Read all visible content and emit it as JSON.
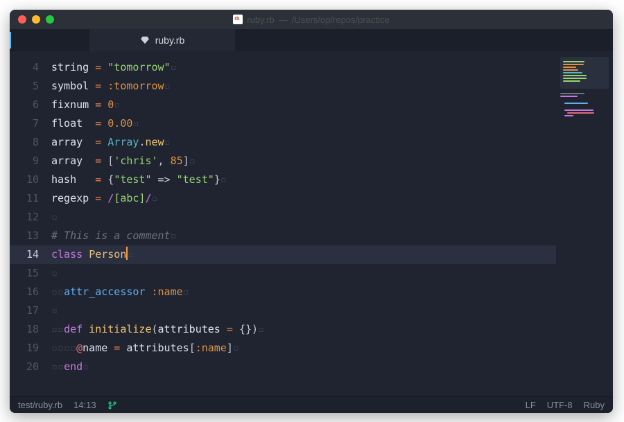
{
  "title": {
    "file": "ruby.rb",
    "path": "/Users/op/repos/practice",
    "sep": " — "
  },
  "tab": {
    "name": "ruby.rb"
  },
  "gutter": {
    "start": 4,
    "end": 20,
    "highlight": 14
  },
  "code": {
    "l4": {
      "var": "string",
      "op": "=",
      "str": "\"tomorrow\""
    },
    "l5": {
      "var": "symbol",
      "op": "=",
      "sym": ":tomorrow"
    },
    "l6": {
      "var": "fixnum",
      "op": "=",
      "num": "0"
    },
    "l7": {
      "var": "float ",
      "op": "=",
      "num": "0.00"
    },
    "l8": {
      "var": "array ",
      "op": "=",
      "const": "Array",
      "dot": ".",
      "meth": "new"
    },
    "l9": {
      "var": "array ",
      "op": "=",
      "lb": "[",
      "str": "'chris'",
      "comma": ", ",
      "num": "85",
      "rb": "]"
    },
    "l10": {
      "var": "hash  ",
      "op": "=",
      "lb": "{",
      "k": "\"test\"",
      "arrow": " => ",
      "v": "\"test\"",
      "rb": "}"
    },
    "l11": {
      "var": "regexp",
      "op": "=",
      "slash1": "/",
      "body": "[abc]",
      "slash2": "/"
    },
    "l13": {
      "comment": "# This is a comment"
    },
    "l14": {
      "kw": "class",
      "name": "Person"
    },
    "l16": {
      "attr": "attr_accessor",
      "sym": ":name"
    },
    "l18": {
      "kw": "def",
      "meth": "initialize",
      "lp": "(",
      "arg": "attributes",
      "opeq": " = ",
      "lb": "{}",
      "rp": ")"
    },
    "l19": {
      "at": "@",
      "ivar": "name",
      "opeq": " = ",
      "rhs": "attributes",
      "lb": "[",
      "sym": ":name",
      "rb": "]"
    },
    "l20": {
      "kw": "end"
    }
  },
  "status": {
    "path": "test/ruby.rb",
    "cursor": "14:13",
    "line_ending": "LF",
    "encoding": "UTF-8",
    "language": "Ruby"
  },
  "minimap": {
    "colors": [
      "#98d472",
      "#de9243",
      "#de9243",
      "#de9243",
      "#56b6c2",
      "#98d472",
      "#98d472",
      "#98d472",
      "#6c7380",
      "#c678dd",
      "#61afef",
      "#c678dd",
      "#e06c75",
      "#c678dd"
    ]
  }
}
